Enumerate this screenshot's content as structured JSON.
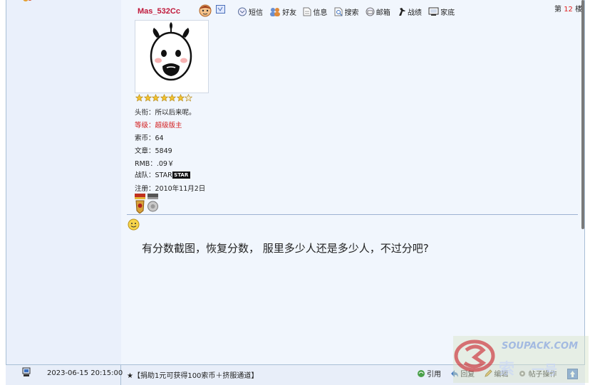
{
  "post": {
    "username": "Mas_532Cc",
    "floor_prefix": "第",
    "floor_number": "12",
    "floor_suffix": "楼",
    "actions": [
      "短信",
      "好友",
      "信息",
      "搜索",
      "邮箱",
      "战绩",
      "家底"
    ],
    "rating_stars": 6,
    "rating_max": 7,
    "title_line": "头衔：所以后来呢。",
    "level_line": "等级：超级版主",
    "coins_line": "索币：64",
    "articles_line": "文章：5849",
    "rmb_line": "RMB：.09￥",
    "team_line": "战队：STAR",
    "team_logo_text": "STAR",
    "register_line": "注册：2010年11月2日",
    "content": "有分数截图，恢复分数， 服里多少人还是多少人，不过分吧?"
  },
  "footer": {
    "timestamp": "2023-06-15 20:15:00",
    "ad_text": "★【捐助1元可获得100索币＋挤服通道】",
    "actions": [
      "引用",
      "回复",
      "编辑",
      "帖子操作"
    ]
  },
  "watermark": {
    "line1": "SOUPACK.COM",
    "line2": "索",
    "line3": "一号"
  },
  "colors": {
    "username": "#c0183a",
    "level": "#d21a1a",
    "floor_number": "#e02020",
    "sidebar_bg": "#eaf0fb",
    "main_bg": "#f1f6fd",
    "border": "#a9bfd6"
  }
}
